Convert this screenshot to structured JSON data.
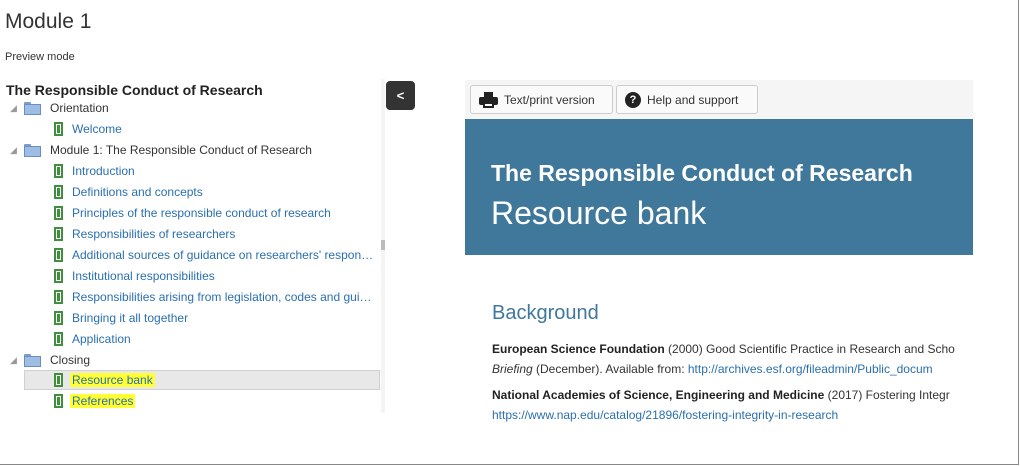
{
  "page": {
    "title": "Module 1",
    "mode": "Preview mode"
  },
  "tree": {
    "title": "The Responsible Conduct of Research",
    "orientation": {
      "label": "Orientation",
      "items": [
        "Welcome"
      ]
    },
    "module1": {
      "label": "Module 1: The Responsible Conduct of Research",
      "items": [
        "Introduction",
        "Definitions and concepts",
        "Principles of the responsible conduct of research",
        "Responsibilities of researchers",
        "Additional sources of guidance on researchers' responsib...",
        "Institutional responsibilities",
        "Responsibilities arising from legislation, codes and guidel...",
        "Bringing it all together",
        "Application"
      ]
    },
    "closing": {
      "label": "Closing",
      "items": [
        "Resource bank",
        "References"
      ],
      "selected": "Resource bank"
    }
  },
  "collapse_button": {
    "label": "<"
  },
  "viewer": {
    "toolbar": {
      "print_label": "Text/print version",
      "help_label": "Help and support"
    },
    "banner": {
      "title": "The Responsible Conduct of Research",
      "subtitle": "Resource bank"
    },
    "section_heading": "Background",
    "refs": [
      {
        "author": "European Science Foundation",
        "line1": " (2000) Good Scientific Practice in Research and Scho",
        "italic": "Briefing",
        "line2": " (December). Available from: ",
        "link": "http://archives.esf.org/fileadmin/Public_docum"
      },
      {
        "author": "National Academies of Science, Engineering and Medicine",
        "line1": " (2017) Fostering Integr",
        "link": "https://www.nap.edu/catalog/21896/fostering-integrity-in-research"
      }
    ]
  },
  "colors": {
    "banner": "#3f789b",
    "link": "#2a6fb0",
    "highlight": "#ffff33",
    "leaf_icon": "#3f8f3f"
  },
  "icons": {
    "print": "printer-icon",
    "help": "question-circle-icon",
    "folder": "folder-icon",
    "page": "page-icon"
  }
}
